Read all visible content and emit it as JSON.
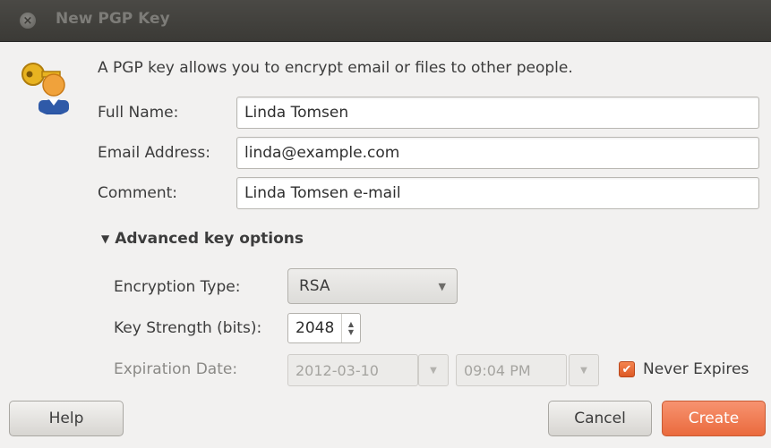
{
  "window": {
    "title": "New PGP Key",
    "close_glyph": "×"
  },
  "description": "A PGP key allows you to encrypt email or files to other people.",
  "form": {
    "full_name_label": "Full Name:",
    "full_name_value": "Linda Tomsen",
    "email_label": "Email Address:",
    "email_value": "linda@example.com",
    "comment_label": "Comment:",
    "comment_value": "Linda Tomsen e-mail"
  },
  "advanced": {
    "toggle_glyph": "▼",
    "toggle_label": "Advanced key options",
    "encryption_type_label": "Encryption Type:",
    "encryption_type_value": "RSA",
    "key_strength_label": "Key Strength (bits):",
    "key_strength_value": "2048",
    "expiration_label": "Expiration Date:",
    "expiration_date_value": "2012-03-10",
    "expiration_time_value": "09:04 PM",
    "never_expires_label": "Never Expires",
    "never_expires_checked": true
  },
  "buttons": {
    "help": "Help",
    "cancel": "Cancel",
    "create": "Create"
  },
  "colors": {
    "accent": "#ea6a3d",
    "titlebar": "#3b3a36"
  },
  "icons": {
    "dialog_icon": "key-pair-icon",
    "close": "close-icon",
    "dropdown": "chevron-down-icon",
    "spin": "spin-arrows-icon",
    "check": "checkmark-icon"
  }
}
